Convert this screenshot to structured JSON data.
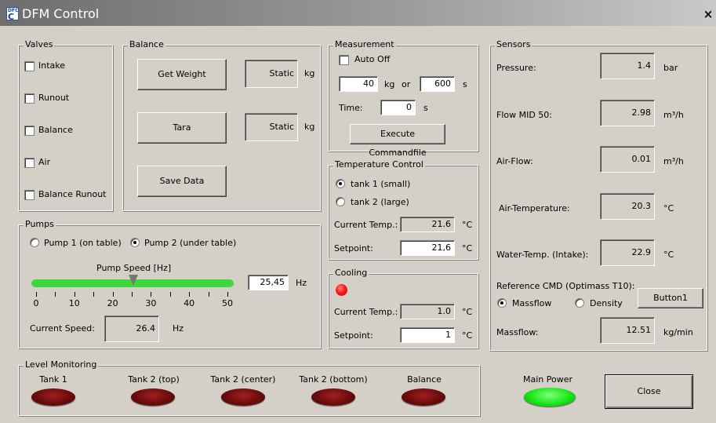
{
  "window": {
    "title": "DFM Control",
    "icon_text_top": "DFC",
    "icon_text_bottom": "C",
    "close_glyph": "×"
  },
  "valves": {
    "title": "Valves",
    "items": [
      {
        "label": "Intake",
        "checked": false
      },
      {
        "label": "Runout",
        "checked": false
      },
      {
        "label": "Balance",
        "checked": false
      },
      {
        "label": "Air",
        "checked": false
      },
      {
        "label": "Balance Runout",
        "checked": false
      }
    ]
  },
  "balance": {
    "title": "Balance",
    "get_weight": "Get Weight",
    "tara": "Tara",
    "save_data": "Save Data",
    "weight_value_1": "Static",
    "weight_value_2": "Static",
    "unit": "kg"
  },
  "measurement": {
    "title": "Measurement",
    "auto_off": "Auto Off",
    "kg_value": "40",
    "kg_unit": "kg",
    "or": "or",
    "s_value": "600",
    "s_unit": "s",
    "time_label": "Time:",
    "time_value": "0",
    "execute": "Execute Commandfile"
  },
  "temperature_control": {
    "title": "Temperature Control",
    "tank1": "tank 1 (small)",
    "tank2": "tank 2 (large)",
    "selected": "tank 1 (small)",
    "current_label": "Current Temp.:",
    "current_value": "21.6",
    "setpoint_label": "Setpoint:",
    "setpoint_value": "21,6",
    "unit": "°C"
  },
  "cooling": {
    "title": "Cooling",
    "current_label": "Current Temp.:",
    "current_value": "1.0",
    "setpoint_label": "Setpoint:",
    "setpoint_value": "1",
    "unit": "°C",
    "led_color": "#ff1a1a"
  },
  "pumps": {
    "title": "Pumps",
    "pump1": "Pump 1 (on table)",
    "pump2": "Pump 2 (under table)",
    "selected": "Pump 2 (under table)",
    "speed_label": "Pump Speed [Hz]",
    "speed_value": "25,45",
    "speed_unit": "Hz",
    "slider_value": 25.45,
    "slider_min": 0,
    "slider_max": 50,
    "ticks": [
      "0",
      "10",
      "20",
      "30",
      "40",
      "50"
    ],
    "current_label": "Current Speed:",
    "current_value": "26.4",
    "current_unit": "Hz"
  },
  "sensors": {
    "title": "Sensors",
    "rows": [
      {
        "label": "Pressure:",
        "value": "1.4",
        "unit": "bar"
      },
      {
        "label": "Flow MID 50:",
        "value": "2.98",
        "unit": "m³/h"
      },
      {
        "label": "Air-Flow:",
        "value": "0.01",
        "unit": "m³/h"
      },
      {
        "label": "Air-Temperature:",
        "value": "20.3",
        "unit": "°C"
      },
      {
        "label": "Water-Temp. (Intake):",
        "value": "22.9",
        "unit": "°C"
      }
    ],
    "reference_label": "Reference CMD (Optimass T10):",
    "massflow_radio": "Massflow",
    "density_radio": "Density",
    "selected": "Massflow",
    "button1": "Button1",
    "massflow_label": "Massflow:",
    "massflow_value": "12.51",
    "massflow_unit": "kg/min"
  },
  "level_monitoring": {
    "title": "Level Monitoring",
    "tanks": [
      "Tank 1",
      "Tank 2 (top)",
      "Tank 2 (center)",
      "Tank 2 (bottom)",
      "Balance"
    ],
    "led_color": "#6a0c0c"
  },
  "main_power": {
    "label": "Main Power",
    "led_color": "#19e619"
  },
  "close_button": "Close"
}
